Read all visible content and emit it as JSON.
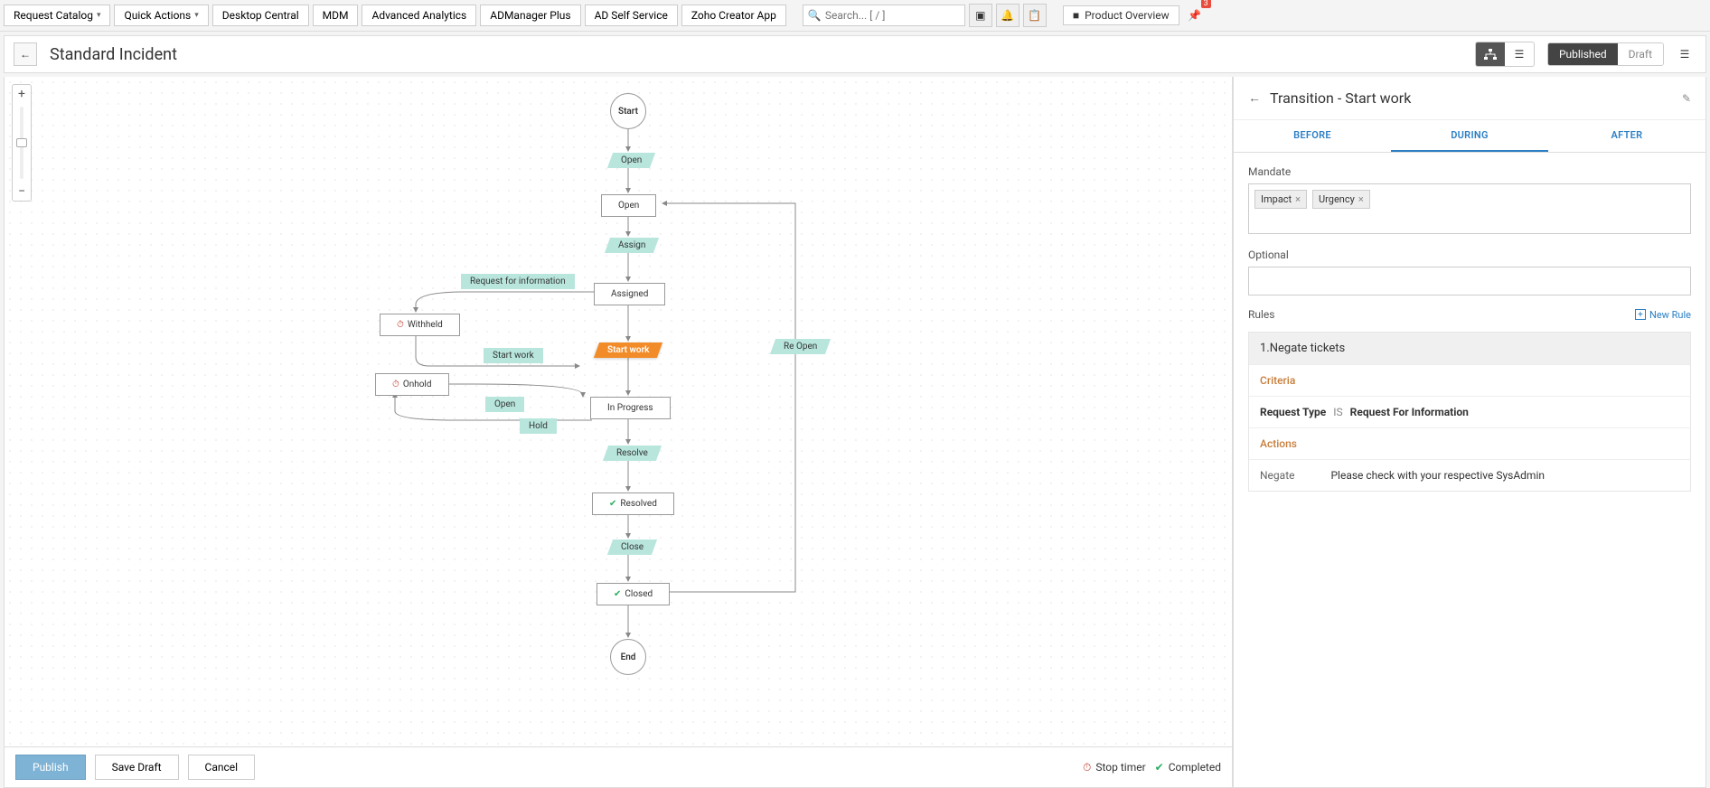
{
  "topbar": {
    "request_catalog": "Request Catalog",
    "quick_actions": "Quick Actions",
    "links": [
      "Desktop Central",
      "MDM",
      "Advanced Analytics",
      "ADManager Plus",
      "AD Self Service",
      "Zoho Creator App"
    ],
    "search_placeholder": "Search... [ / ]",
    "product_overview": "Product Overview",
    "badge_count": "3"
  },
  "header": {
    "title": "Standard Incident",
    "published": "Published",
    "draft": "Draft"
  },
  "flow": {
    "start": "Start",
    "end": "End",
    "states": {
      "open": "Open",
      "assigned": "Assigned",
      "withheld": "Withheld",
      "onhold": "Onhold",
      "in_progress": "In Progress",
      "resolved": "Resolved",
      "closed": "Closed"
    },
    "transitions": {
      "open": "Open",
      "assign": "Assign",
      "rfi": "Request for information",
      "start_work": "Start work",
      "start_work_sel": "Start work",
      "re_open": "Re Open",
      "open2": "Open",
      "hold": "Hold",
      "resolve": "Resolve",
      "close": "Close"
    }
  },
  "footer": {
    "publish": "Publish",
    "save_draft": "Save Draft",
    "cancel": "Cancel",
    "stop_timer": "Stop timer",
    "completed": "Completed"
  },
  "panel": {
    "title": "Transition - Start work",
    "tabs": {
      "before": "BEFORE",
      "during": "DURING",
      "after": "AFTER"
    },
    "mandate_label": "Mandate",
    "mandate_tags": [
      "Impact",
      "Urgency"
    ],
    "optional_label": "Optional",
    "rules_label": "Rules",
    "new_rule": "New Rule",
    "rule": {
      "title": "1.Negate tickets",
      "criteria_label": "Criteria",
      "criteria_field": "Request Type",
      "criteria_op": "IS",
      "criteria_value": "Request For Information",
      "actions_label": "Actions",
      "action_name": "Negate",
      "action_msg": "Please check with your respective SysAdmin"
    }
  }
}
